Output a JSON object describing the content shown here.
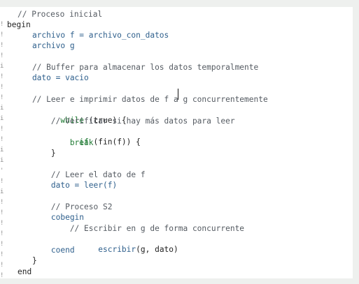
{
  "editor": {
    "gutter_marks": [
      "!",
      "!",
      "!",
      "!",
      "i",
      "!",
      "!",
      "!",
      "i",
      "i",
      "!",
      "!",
      "i",
      "i",
      "'",
      "!",
      "i",
      "!",
      "!",
      "!",
      "!",
      "!",
      "!",
      "!",
      "!"
    ],
    "lines": [
      {
        "text": "// Proceso inicial",
        "kind": "comment"
      },
      {
        "text": "begin",
        "kind": "keyword-plain"
      },
      {
        "text": "    archivo f = archivo_con_datos",
        "kind": "ident"
      },
      {
        "text": "    archivo g",
        "kind": "ident"
      },
      {
        "text": "",
        "kind": "plain"
      },
      {
        "text": "    // Buffer para almacenar los datos temporalmente",
        "kind": "comment"
      },
      {
        "text": "    dato = vacio",
        "kind": "ident"
      },
      {
        "text": "",
        "kind": "plain"
      },
      {
        "text": "    // Leer e imprimir datos de f a g concurrentemente",
        "kind": "comment"
      },
      {
        "text_keyword": "    while",
        "text_rest": " (true) {",
        "kind": "mixed"
      },
      {
        "text": "        // Verificar si hay más datos para leer",
        "kind": "comment"
      },
      {
        "text_keyword": "        if",
        "text_rest": " (fin(f)) {",
        "kind": "mixed"
      },
      {
        "text": "            break",
        "kind": "keyword"
      },
      {
        "text": "        }",
        "kind": "plain"
      },
      {
        "text": "",
        "kind": "plain"
      },
      {
        "text": "        // Leer el dato de f",
        "kind": "comment"
      },
      {
        "text": "        dato = leer(f)",
        "kind": "ident"
      },
      {
        "text": "",
        "kind": "plain"
      },
      {
        "text": "        // Proceso S2",
        "kind": "comment"
      },
      {
        "text": "        cobegin",
        "kind": "ident"
      },
      {
        "text": "            // Escribir en g de forma concurrente",
        "kind": "comment"
      },
      {
        "text_ident": "            escribir",
        "text_rest": "(g, dato)",
        "kind": "mixed-ident"
      },
      {
        "text": "        coend",
        "kind": "ident"
      },
      {
        "text": "    }",
        "kind": "plain"
      },
      {
        "text": "end",
        "kind": "plain"
      }
    ]
  }
}
